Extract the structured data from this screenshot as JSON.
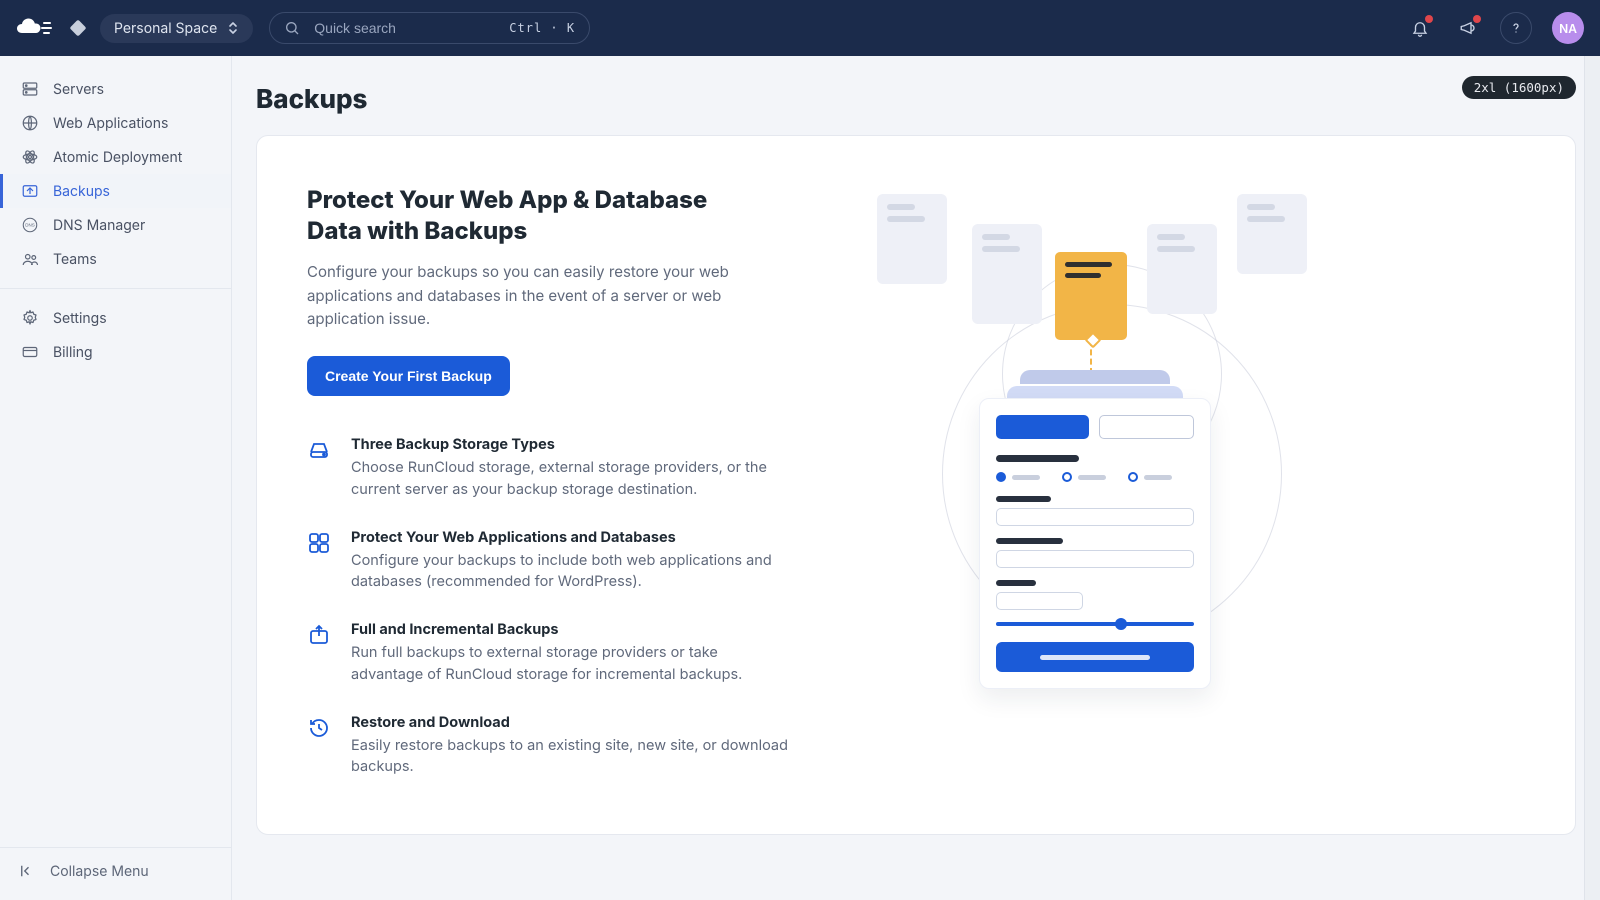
{
  "header": {
    "workspace_label": "Personal Space",
    "search_placeholder": "Quick search",
    "search_shortcut": "Ctrl · K",
    "avatar_initials": "NA"
  },
  "sidebar": {
    "primary": [
      {
        "id": "servers",
        "label": "Servers",
        "icon": "server-icon"
      },
      {
        "id": "webapps",
        "label": "Web Applications",
        "icon": "globe-icon"
      },
      {
        "id": "atomic",
        "label": "Atomic Deployment",
        "icon": "atom-icon"
      },
      {
        "id": "backups",
        "label": "Backups",
        "icon": "backup-icon"
      },
      {
        "id": "dns",
        "label": "DNS Manager",
        "icon": "dns-icon"
      },
      {
        "id": "teams",
        "label": "Teams",
        "icon": "team-icon"
      }
    ],
    "secondary": [
      {
        "id": "settings",
        "label": "Settings",
        "icon": "gear-icon"
      },
      {
        "id": "billing",
        "label": "Billing",
        "icon": "card-icon"
      }
    ],
    "active_id": "backups",
    "collapse_label": "Collapse Menu"
  },
  "main": {
    "page_title": "Backups",
    "breakpoint_badge": "2xl (1600px)",
    "hero_title": "Protect Your Web App & Database Data with Backups",
    "hero_sub": "Configure your backups so you can easily restore your web applications and databases in the event of a server or web application issue.",
    "cta_label": "Create Your First Backup",
    "features": [
      {
        "icon": "drive-icon",
        "title": "Three Backup Storage Types",
        "desc": "Choose RunCloud storage, external storage providers, or the current server as your backup storage destination."
      },
      {
        "icon": "grid4-icon",
        "title": "Protect Your Web Applications and Databases",
        "desc": "Configure your backups to include both web applications and databases (recommended for WordPress)."
      },
      {
        "icon": "upload-box-icon",
        "title": "Full and Incremental Backups",
        "desc": "Run full backups to external storage providers or take advantage of RunCloud storage for incremental backups."
      },
      {
        "icon": "history-icon",
        "title": "Restore and Download",
        "desc": "Easily restore backups to an existing site, new site, or download backups."
      }
    ]
  }
}
